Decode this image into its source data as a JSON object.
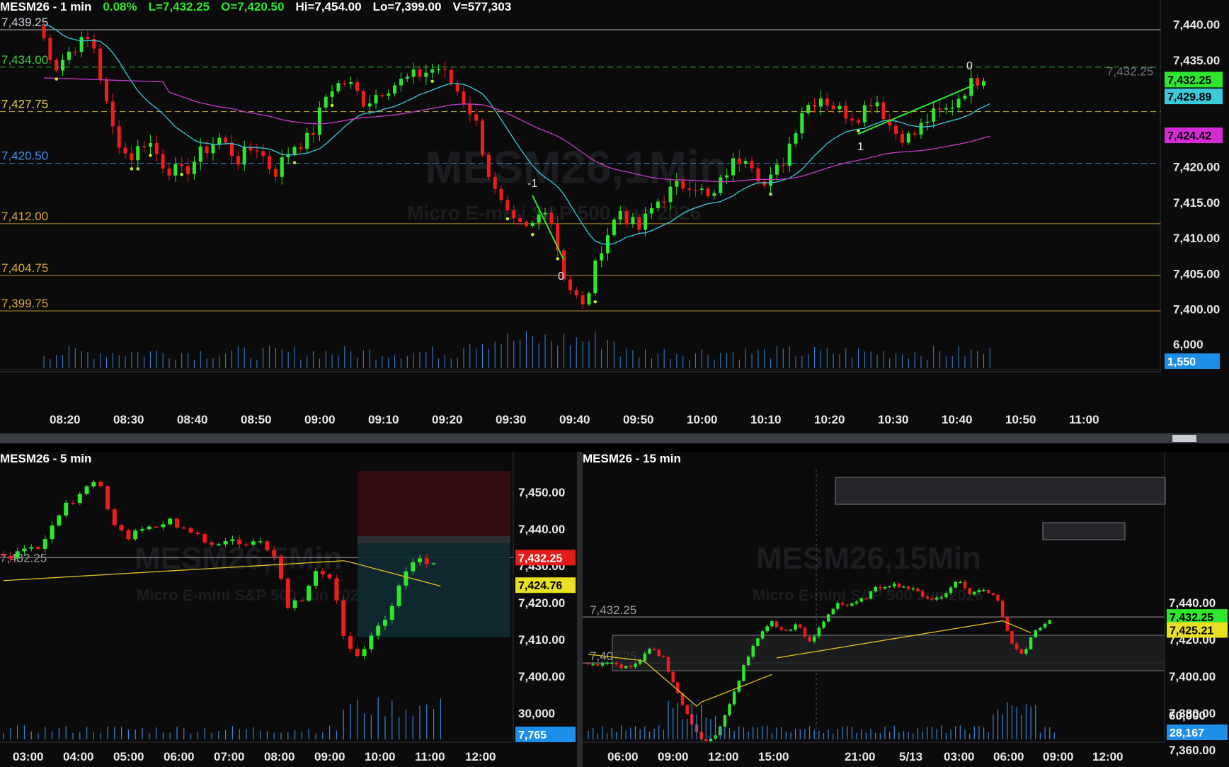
{
  "top": {
    "symbol": "MESM26 - 1 min",
    "change_pct": "0.08%",
    "last": "L=7,432.25",
    "open": "O=7,420.50",
    "high": "Hi=7,454.00",
    "low": "Lo=7,399.00",
    "volume": "V=577,303",
    "watermark_title": "MESM26,1Min",
    "watermark_sub": "Micro E-mini S&P 500 Jun 2026",
    "y_axis": [
      "7,440.00",
      "7,435.00",
      "7,430.00",
      "7,425.00",
      "7,420.00",
      "7,415.00",
      "7,410.00",
      "7,405.00",
      "7,400.00"
    ],
    "vol_axis": "6,000",
    "vol_badge": "1,550",
    "price_badges": [
      "7,432.25",
      "7,429.89",
      "7,424.42"
    ],
    "last_price_text": "7,432.25",
    "levels": [
      {
        "label": "7,439.25",
        "price": 7439.25,
        "color": "#cfd3da",
        "style": "solid"
      },
      {
        "label": "7,434.00",
        "price": 7434.0,
        "color": "#3fcf3f",
        "style": "dashed"
      },
      {
        "label": "7,427.75",
        "price": 7427.75,
        "color": "#e6d24a",
        "style": "dashed"
      },
      {
        "label": "7,420.50",
        "price": 7420.5,
        "color": "#3f8fe8",
        "style": "dashed"
      },
      {
        "label": "7,412.00",
        "price": 7412.0,
        "color": "#d9a53a",
        "style": "solid"
      },
      {
        "label": "7,404.75",
        "price": 7404.75,
        "color": "#d9a53a",
        "style": "solid"
      },
      {
        "label": "7,399.75",
        "price": 7399.75,
        "color": "#d9a53a",
        "style": "solid"
      }
    ],
    "x_axis": [
      "08:20",
      "08:30",
      "08:40",
      "08:50",
      "09:00",
      "09:10",
      "09:20",
      "09:30",
      "09:40",
      "09:50",
      "10:00",
      "10:10",
      "10:20",
      "10:30",
      "10:40",
      "10:50",
      "11:00"
    ],
    "annotations": [
      "-1",
      "0",
      "1",
      "0"
    ]
  },
  "bottom_left": {
    "symbol": "MESM26 - 5 min",
    "watermark_title": "MESM26,5Min",
    "watermark_sub": "Micro E-mini S&P 500 Jun 2026",
    "level_label": "7,432.25",
    "y_axis": [
      "7,450.00",
      "7,440.00",
      "7,430.00",
      "7,420.00",
      "7,410.00",
      "7,400.00"
    ],
    "vol_axis": "30,000",
    "vol_badge": "7,765",
    "price_badges": [
      "7,432.25",
      "7,424.76"
    ],
    "x_axis": [
      "03:00",
      "04:00",
      "05:00",
      "06:00",
      "07:00",
      "08:00",
      "09:00",
      "10:00",
      "11:00",
      "12:00"
    ]
  },
  "bottom_right": {
    "symbol": "MESM26 - 15 min",
    "watermark_title": "MESM26,15Min",
    "watermark_sub": "Micro E-mini S&P 500 Jun 2026",
    "level_labels": [
      "7,432.25",
      "7,407.25"
    ],
    "y_axis": [
      "7,440.00",
      "7,420.00",
      "7,400.00",
      "7,380.00",
      "7,360.00"
    ],
    "vol_axis": "60,000",
    "vol_badge": "28,167",
    "price_badges": [
      "7,432.25",
      "7,425.21"
    ],
    "x_axis": [
      "06:00",
      "09:00",
      "12:00",
      "15:00",
      "21:00",
      "5/13",
      "03:00",
      "06:00",
      "09:00",
      "12:00"
    ]
  },
  "colors": {
    "up": "#2ee62e",
    "down": "#ee1c1c",
    "ema": "#3cc9d8",
    "sma": "#c83ac8",
    "avg": "#e2c21e",
    "bg": "#0b0b0c"
  }
}
